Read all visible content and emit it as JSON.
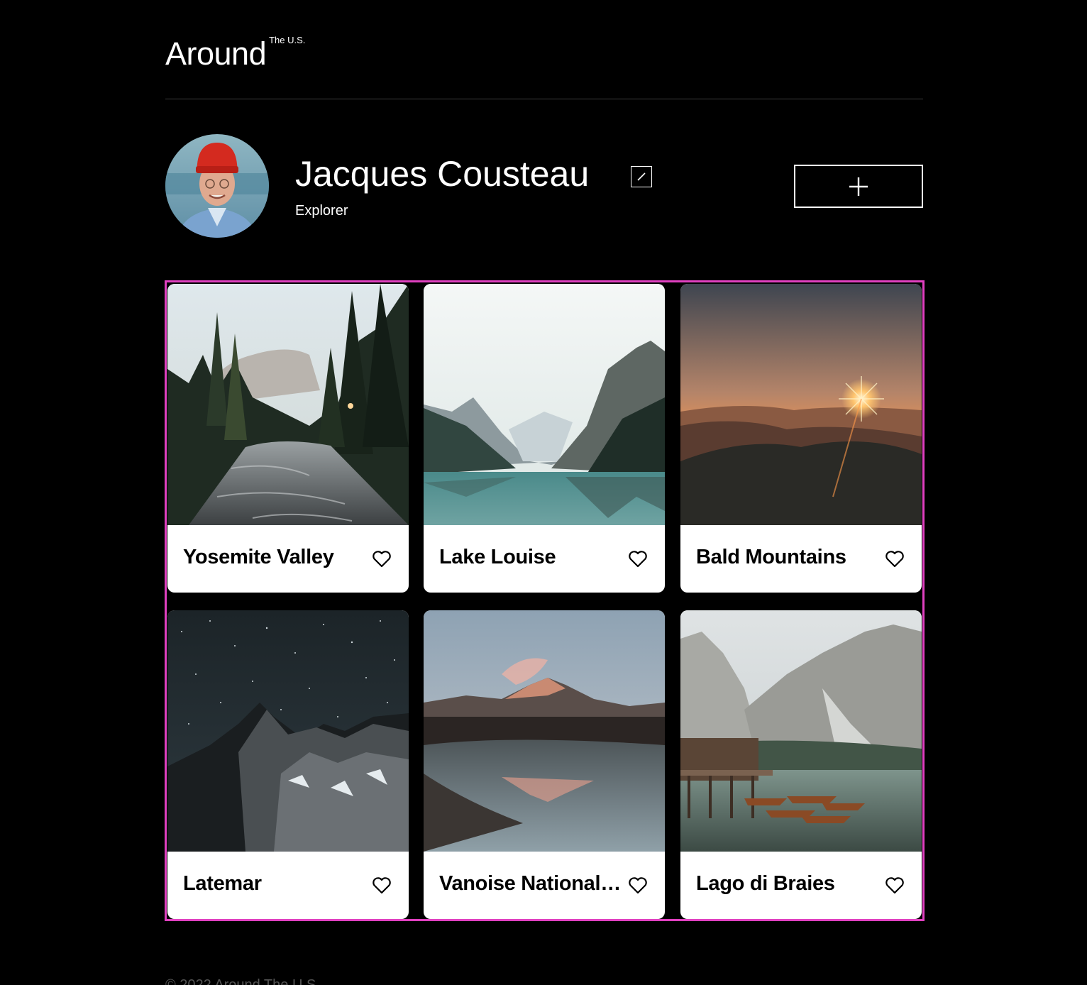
{
  "header": {
    "logo_main": "Around",
    "logo_sup": "The U.S."
  },
  "profile": {
    "name": "Jacques Cousteau",
    "about": "Explorer"
  },
  "cards": [
    {
      "title": "Yosemite Valley"
    },
    {
      "title": "Lake Louise"
    },
    {
      "title": "Bald Mountains"
    },
    {
      "title": "Latemar"
    },
    {
      "title": "Vanoise National Park"
    },
    {
      "title": "Lago di Braies"
    }
  ],
  "footer": {
    "text": "© 2022 Around The U.S."
  },
  "colors": {
    "background": "#000000",
    "card": "#ffffff",
    "highlight": "#e040c0",
    "divider": "#3f3f3f"
  }
}
